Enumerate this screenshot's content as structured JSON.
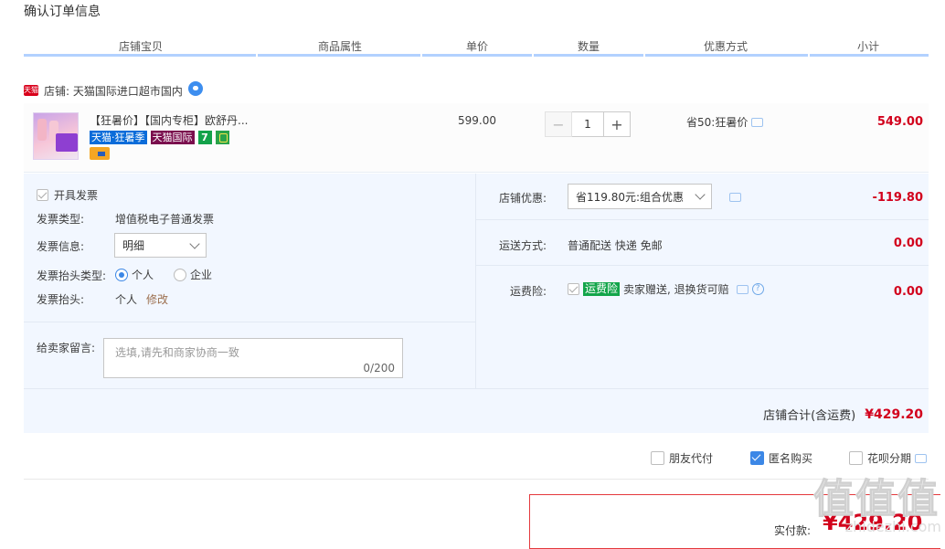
{
  "page_title": "确认订单信息",
  "columns": [
    "店铺宝贝",
    "商品属性",
    "单价",
    "数量",
    "优惠方式",
    "小计"
  ],
  "store": {
    "logo_text": "天猫",
    "label": "店铺: 天猫国际进口超市国内"
  },
  "item": {
    "title": "【狂暑价】【国内专柜】欧舒丹...",
    "badges": [
      "天猫·狂暑季",
      "天猫国际",
      "7"
    ],
    "unit_price": "599.00",
    "quantity": "1",
    "minus": "−",
    "plus": "+",
    "promo": "省50:狂暑价",
    "subtotal": "549.00"
  },
  "invoice": {
    "open_label": "开具发票",
    "type_label": "发票类型:",
    "type_value": "增值税电子普通发票",
    "info_label": "发票信息:",
    "info_value": "明细",
    "header_type_label": "发票抬头类型:",
    "header_type_options": [
      "个人",
      "企业"
    ],
    "header_label": "发票抬头:",
    "header_value": "个人",
    "header_edit": "修改"
  },
  "message": {
    "label": "给卖家留言:",
    "placeholder": "选填,请先和商家协商一致",
    "counter": "0/200"
  },
  "store_discount": {
    "label": "店铺优惠:",
    "value": "省119.80元:组合优惠",
    "amount": "-119.80"
  },
  "shipping": {
    "label": "运送方式:",
    "value": "普通配送 快递 免邮",
    "amount": "0.00"
  },
  "insurance": {
    "label": "运费险:",
    "badge": "运费险",
    "desc": "卖家赠送, 退换货可赔",
    "amount": "0.00"
  },
  "store_total": {
    "label": "店铺合计(含运费)",
    "amount": "¥429.20"
  },
  "options": [
    {
      "label": "朋友代付",
      "checked": false
    },
    {
      "label": "匿名购买",
      "checked": true
    },
    {
      "label": "花呗分期",
      "checked": false
    }
  ],
  "pay": {
    "label": "实付款:",
    "amount": "¥429.20"
  },
  "watermark": {
    "big": "值值值",
    "small": "zhidezhi.com"
  }
}
